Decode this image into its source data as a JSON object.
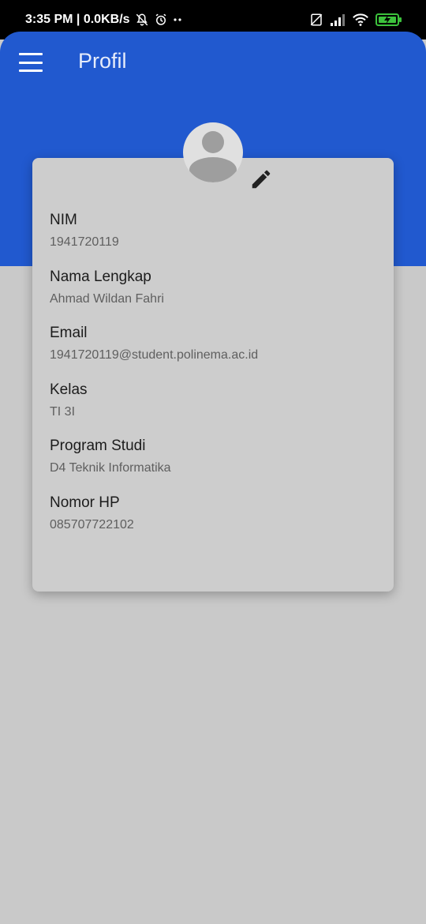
{
  "status_bar": {
    "time_and_speed": "3:35 PM | 0.0KB/s",
    "icons": [
      "bell-off-icon",
      "alarm-icon",
      "dots-icon",
      "sim-off-icon",
      "signal-icon",
      "wifi-icon",
      "battery-charging-icon"
    ]
  },
  "app_bar": {
    "title": "Profil",
    "menu_icon": "hamburger-menu-icon",
    "color": "#2159cf"
  },
  "profile": {
    "avatar_icon": "person-icon",
    "edit_icon": "pencil-icon",
    "fields": [
      {
        "label": "NIM",
        "value": "1941720119"
      },
      {
        "label": "Nama Lengkap",
        "value": "Ahmad Wildan Fahri"
      },
      {
        "label": "Email",
        "value": "1941720119@student.polinema.ac.id"
      },
      {
        "label": "Kelas",
        "value": "TI 3I"
      },
      {
        "label": "Program Studi",
        "value": "D4 Teknik Informatika"
      },
      {
        "label": "Nomor HP",
        "value": "085707722102"
      }
    ]
  }
}
